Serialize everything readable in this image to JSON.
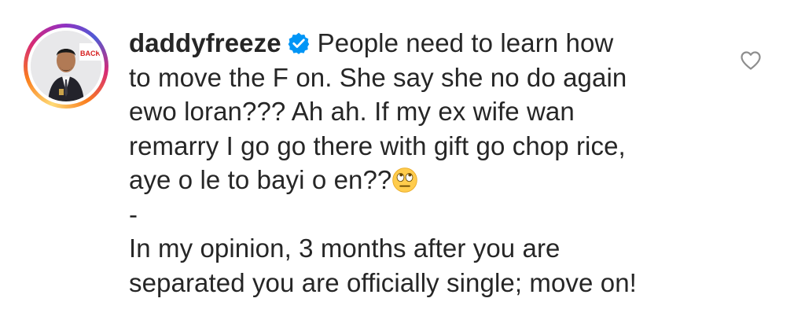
{
  "comment": {
    "username": "daddyfreeze",
    "lines": {
      "l1": "People need to learn how",
      "l2": "to move the F on. She say she no do again",
      "l3": "ewo loran??? Ah ah. If my ex wife wan",
      "l4": "remarry I go go there with gift go chop rice,",
      "l5": "aye o le to bayi o en??",
      "l6": "-",
      "l7": "In my opinion, 3 months after you are",
      "l8": "separated you are officially single; move on!"
    },
    "emoji_name": "face-with-rolling-eyes",
    "verified_icon": "verified-badge-icon",
    "like_icon": "heart-icon"
  },
  "colors": {
    "text": "#262626",
    "verified": "#0095f6",
    "heart_outline": "#8e8e8e"
  },
  "avatar": {
    "badge_text": "BACK"
  }
}
